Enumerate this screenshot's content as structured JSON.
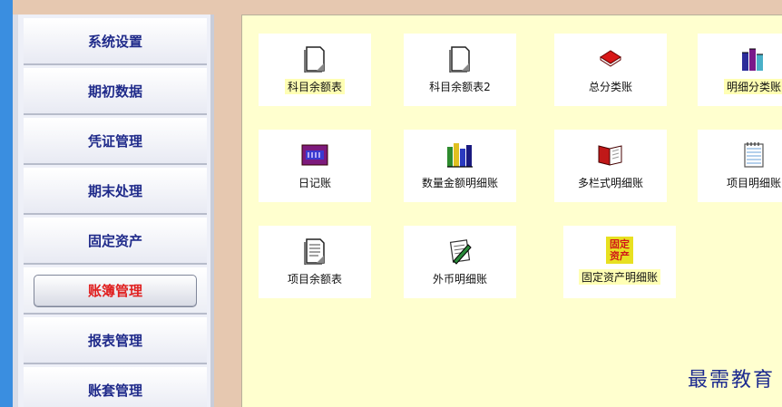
{
  "sidebar": {
    "items": [
      {
        "label": "系统设置"
      },
      {
        "label": "期初数据"
      },
      {
        "label": "凭证管理"
      },
      {
        "label": "期末处理"
      },
      {
        "label": "固定资产"
      },
      {
        "label": "账簿管理",
        "active": true
      },
      {
        "label": "报表管理"
      },
      {
        "label": "账套管理"
      }
    ]
  },
  "main": {
    "tiles": [
      {
        "label": "科目余额表",
        "icon": "blank-document-icon"
      },
      {
        "label": "科目余额表2",
        "icon": "blank-document-icon"
      },
      {
        "label": "总分类账",
        "icon": "red-book-icon"
      },
      {
        "label": "明细分类账",
        "icon": "book-stack-icon"
      },
      {
        "label": "日记账",
        "icon": "purple-book-icon"
      },
      {
        "label": "数量金额明细账",
        "icon": "colored-books-icon"
      },
      {
        "label": "多栏式明细账",
        "icon": "open-book-icon"
      },
      {
        "label": "项目明细账",
        "icon": "lined-notepad-icon"
      },
      {
        "label": "项目余额表",
        "icon": "text-document-icon"
      },
      {
        "label": "外币明细账",
        "icon": "notepad-pen-icon"
      },
      {
        "label": "固定资产明细账",
        "icon": "fixed-asset-icon"
      }
    ],
    "fixed_asset_icon_text": [
      "固定",
      "资产"
    ]
  },
  "watermark": "最需教育",
  "colors": {
    "sidebar_text": "#1f2a8a",
    "active_text": "#e02020",
    "main_bg": "#ffffcf",
    "left_edge": "#3a8ee0"
  }
}
